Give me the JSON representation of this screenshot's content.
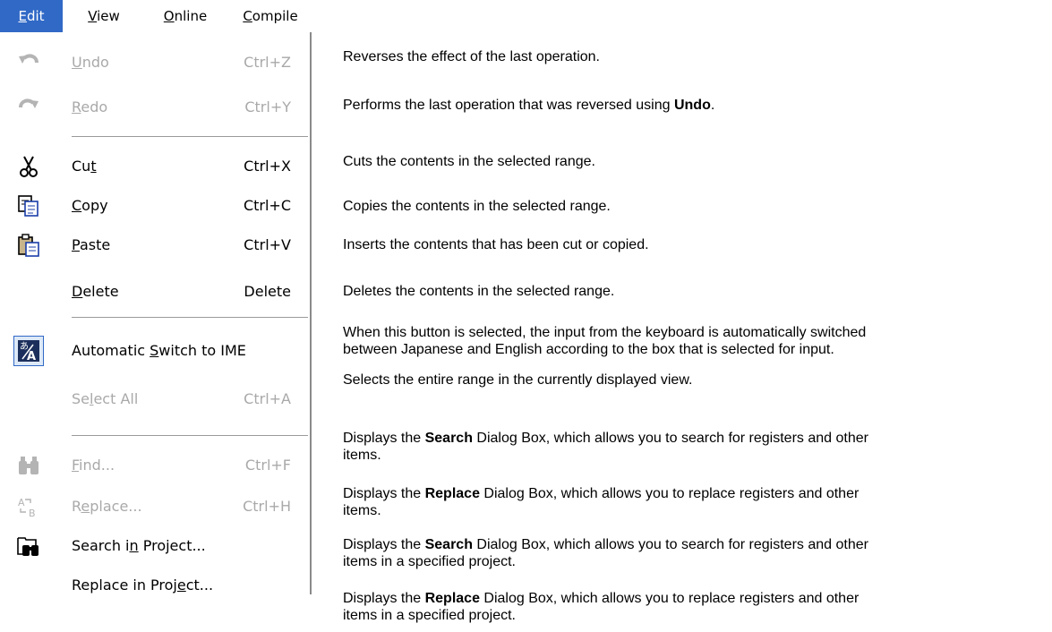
{
  "menubar": {
    "items": [
      {
        "label": "Edit",
        "underline": 0
      },
      {
        "label": "View",
        "underline": 0
      },
      {
        "label": "Online",
        "underline": 0
      },
      {
        "label": "Compile",
        "underline": 0
      }
    ]
  },
  "menu": {
    "items": [
      {
        "label": "Undo",
        "underline": 0,
        "shortcut": "Ctrl+Z",
        "disabled": true,
        "icon": "undo-icon"
      },
      {
        "label": "Redo",
        "underline": 0,
        "shortcut": "Ctrl+Y",
        "disabled": true,
        "icon": "redo-icon"
      },
      {
        "label": "Cut",
        "underline": 2,
        "shortcut": "Ctrl+X",
        "disabled": false,
        "icon": "scissors-icon"
      },
      {
        "label": "Copy",
        "underline": 0,
        "shortcut": "Ctrl+C",
        "disabled": false,
        "icon": "copy-icon"
      },
      {
        "label": "Paste",
        "underline": 0,
        "shortcut": "Ctrl+V",
        "disabled": false,
        "icon": "paste-icon"
      },
      {
        "label": "Delete",
        "underline": 0,
        "shortcut": "Delete",
        "disabled": false,
        "icon": ""
      },
      {
        "label": "Automatic Switch to IME",
        "underline": 10,
        "shortcut": "",
        "disabled": false,
        "icon": "ime-icon"
      },
      {
        "label": "Select All",
        "underline": 2,
        "shortcut": "Ctrl+A",
        "disabled": true,
        "icon": ""
      },
      {
        "label": "Find...",
        "underline": 0,
        "shortcut": "Ctrl+F",
        "disabled": true,
        "icon": "binoculars-icon"
      },
      {
        "label": "Replace...",
        "underline": 1,
        "shortcut": "Ctrl+H",
        "disabled": true,
        "icon": "replace-icon"
      },
      {
        "label": "Search in Project...",
        "underline": 8,
        "shortcut": "",
        "disabled": false,
        "icon": "search-project-icon"
      },
      {
        "label": "Replace in Project...",
        "underline": 15,
        "shortcut": "",
        "disabled": false,
        "icon": ""
      }
    ]
  },
  "descriptions": [
    {
      "lines": [
        [
          {
            "t": "Reverses the effect of the last operation."
          }
        ]
      ]
    },
    {
      "lines": [
        [
          {
            "t": "Performs the last operation that was reversed using "
          },
          {
            "t": "Undo",
            "b": true
          },
          {
            "t": "."
          }
        ]
      ]
    },
    {
      "lines": [
        [
          {
            "t": "Cuts the contents in the selected range."
          }
        ]
      ]
    },
    {
      "lines": [
        [
          {
            "t": "Copies the contents in the selected range."
          }
        ]
      ]
    },
    {
      "lines": [
        [
          {
            "t": "Inserts the contents that has been cut or copied."
          }
        ]
      ]
    },
    {
      "lines": [
        [
          {
            "t": "Deletes the contents in the selected range."
          }
        ]
      ]
    },
    {
      "lines": [
        [
          {
            "t": "When this button is selected, the input from the keyboard is automatically switched"
          }
        ],
        [
          {
            "t": "between Japanese and English according to the box that is selected for input."
          }
        ]
      ]
    },
    {
      "lines": [
        [
          {
            "t": "Selects the entire range in the currently displayed view."
          }
        ]
      ]
    },
    {
      "lines": [
        [
          {
            "t": "Displays the "
          },
          {
            "t": "Search",
            "b": true
          },
          {
            "t": " Dialog Box, which allows you to search for registers and other"
          }
        ],
        [
          {
            "t": "items."
          }
        ]
      ]
    },
    {
      "lines": [
        [
          {
            "t": "Displays the "
          },
          {
            "t": "Replace",
            "b": true
          },
          {
            "t": " Dialog Box, which allows you to replace registers and other"
          }
        ],
        [
          {
            "t": "items."
          }
        ]
      ]
    },
    {
      "lines": [
        [
          {
            "t": "Displays the "
          },
          {
            "t": "Search",
            "b": true
          },
          {
            "t": " Dialog Box, which allows you to search for registers and other"
          }
        ],
        [
          {
            "t": "items in a specified project."
          }
        ]
      ]
    },
    {
      "lines": [
        [
          {
            "t": "Displays the "
          },
          {
            "t": "Replace",
            "b": true
          },
          {
            "t": " Dialog Box, which allows you to replace registers and other"
          }
        ],
        [
          {
            "t": "items in a specified project."
          }
        ]
      ]
    }
  ]
}
